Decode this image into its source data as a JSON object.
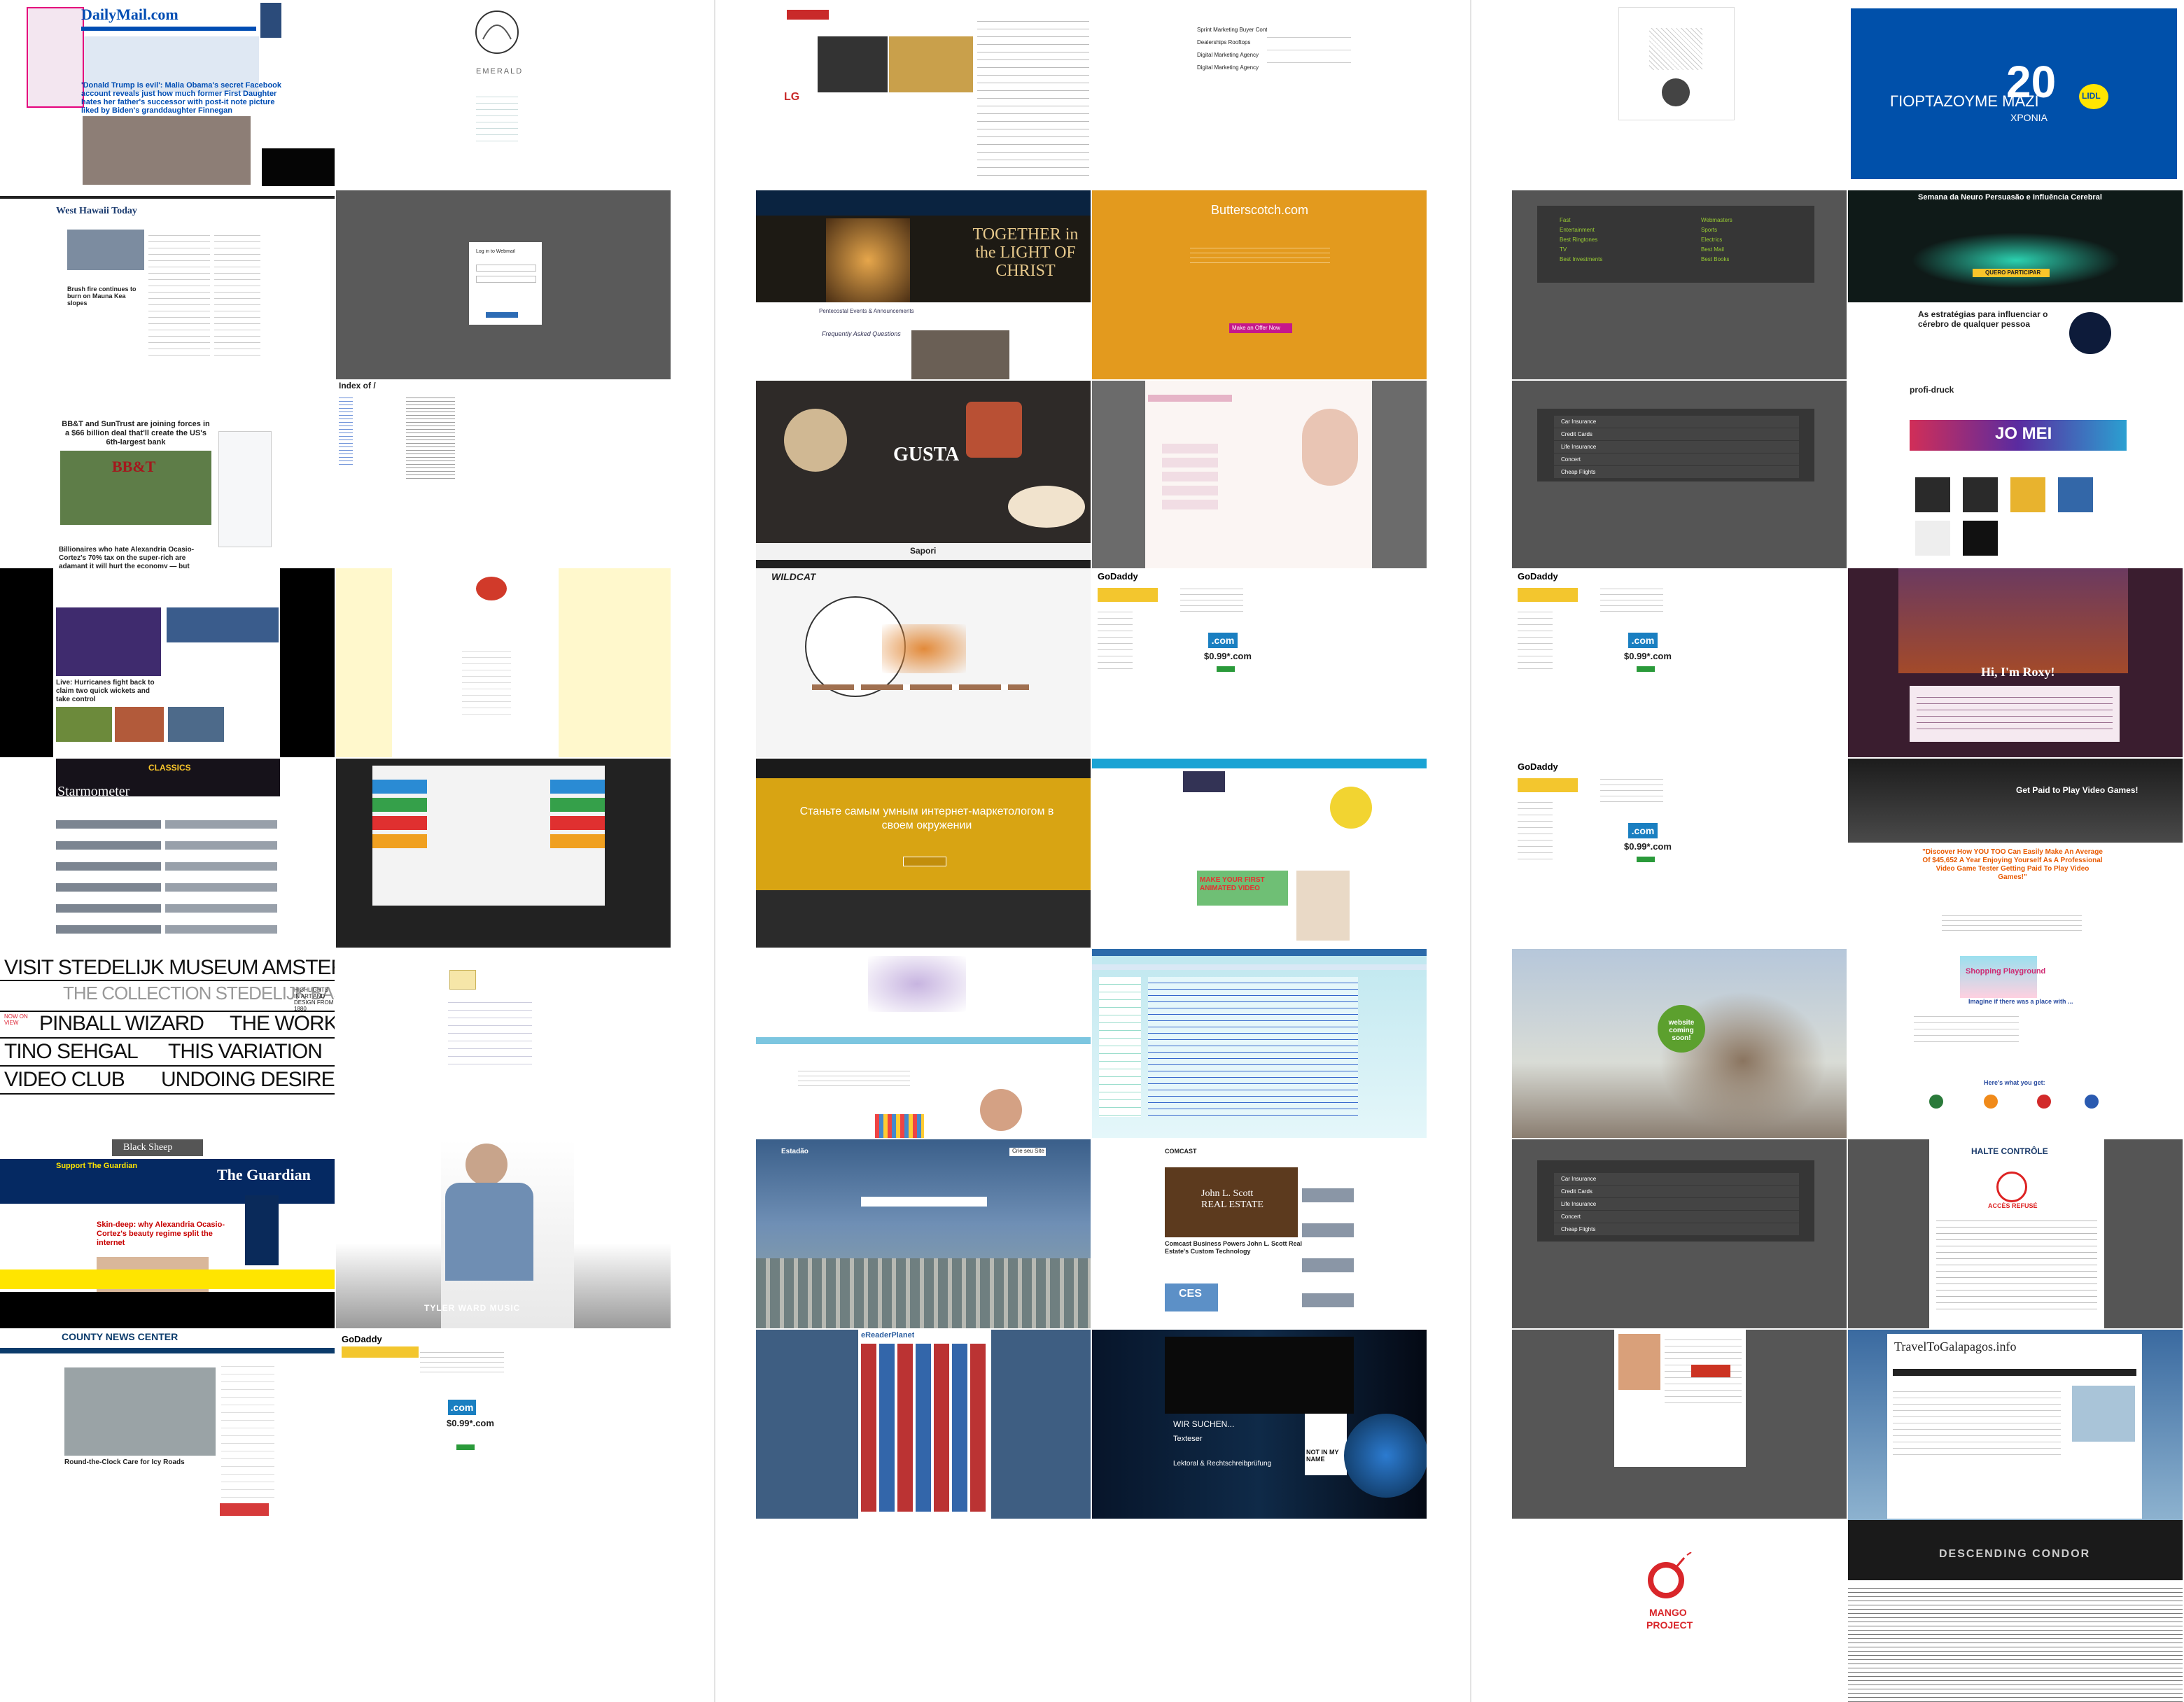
{
  "tiles": {
    "dailymail": {
      "logo": "DailyMail.com",
      "headline": "'Donald Trump is evil': Malia Obama's secret Facebook account reveals just how much former First Daughter hates her father's successor with post-it note picture liked by Biden's granddaughter Finnegan",
      "colors": {
        "brand": "#004db3",
        "accent": "#e4007c"
      }
    },
    "emerald": {
      "title": "EMERALD"
    },
    "chosun": {
      "lg": "LG"
    },
    "spreadsheet": {
      "rows": [
        "Sprint Marketing Buyer Contract",
        "Dealerships Rooftops",
        "Digital Marketing Agency",
        "Digital Marketing Agency"
      ]
    },
    "greetcard": {},
    "lidl": {
      "title": "ΓΙΟΡΤΑΖΟΥΜΕ ΜΑΖΙ",
      "number": "20",
      "sub": "ΧΡΟΝΙΑ",
      "brand": "LIDL",
      "colors": {
        "bg": "#0050aa",
        "accent": "#ffe500"
      }
    },
    "westhawaii": {
      "title": "West Hawaii Today",
      "headline": "Brush fire continues to burn on Mauna Kea slopes"
    },
    "login": {
      "title": "Log in to Webmail"
    },
    "arlington": {
      "title": "TOGETHER in the LIGHT OF CHRIST",
      "heading": "Pentecostal Events & Announcements",
      "sub": "Frequently Asked Questions"
    },
    "butterscotch": {
      "title": "Butterscotch.com",
      "button": "Make an Offer Now",
      "color": "#e39a1e"
    },
    "darkmenu1": {
      "items_left": [
        "Fast",
        "Entertainment",
        "Best Ringtones",
        "TV",
        "Best Investments"
      ],
      "items_right": [
        "Webmasters",
        "Sports",
        "Electrics",
        "Best Mail",
        "Best Books"
      ]
    },
    "neuro": {
      "title": "Semana da Neuro Persuasão e Influência Cerebral",
      "button": "QUERO PARTICIPAR",
      "heading": "As estratégias para influenciar o cérebro de qualquer pessoa"
    },
    "bbt": {
      "headline": "BB&T and SunTrust are joining forces in a $66 billion deal that'll create the US's 6th-largest bank",
      "logo": "BB&T",
      "headline2": "Billionaires who hate Alexandria Ocasio-Cortez's 70% tax on the super-rich are adamant it will hurt the economy — but history suggests otherwise"
    },
    "indexof": {
      "title": "Index of /"
    },
    "gusta": {
      "title": "GUSTA",
      "sub": "Sapori"
    },
    "blurpink": {},
    "darkmenu2": {
      "items": [
        "Car Insurance",
        "Credit Cards",
        "Life Insurance",
        "Concert",
        "Cheap Flights"
      ]
    },
    "profidruck": {
      "logo": "profi-druck",
      "banner": "JO MEI"
    },
    "hurricanes": {
      "headline": "Live: Hurricanes fight back to claim two quick wickets and take control"
    },
    "yellowsite": {},
    "wildcat": {
      "logo": "WILDCAT"
    },
    "godaddy1": {
      "logo": "GoDaddy",
      "domain": ".com",
      "price": "$0.99*.com"
    },
    "godaddy2": {
      "logo": "GoDaddy",
      "domain": ".com",
      "price": "$0.99*.com"
    },
    "roxy": {
      "title": "Hi, I'm Roxy!"
    },
    "starmometer": {
      "logo": "Starmometer",
      "banner": "CLASSICS"
    },
    "ribbons": {},
    "russian": {
      "title": "Станьте самым умным интернет-маркетологом в своем окружении"
    },
    "animated": {
      "banner": "MAKE YOUR FIRST ANIMATED VIDEO"
    },
    "godaddy3": {
      "logo": "GoDaddy",
      "domain": ".com",
      "price": "$0.99*.com"
    },
    "videogame": {
      "header": "Get Paid to Play Video Games!",
      "headline": "\"Discover How YOU TOO Can Easily Make An Average Of $45,652 A Year Enjoying Yourself As A Professional Video Game Tester Getting Paid To Play Video Games!\""
    },
    "stedelijk": {
      "lines": [
        "VISIT STEDELIJK MUSEUM AMSTERDA",
        "THE COLLECTION STEDELIJK BASE",
        "PINBALL WIZARD",
        "THE WORK A",
        "TINO SEHGAL",
        "THIS VARIATION",
        "VIDEO CLUB",
        "UNDOING DESIRE"
      ],
      "small": "HIGHLIGHTS IN ART AND DESIGN FROM 1880",
      "now": "NOW ON VIEW"
    },
    "bookpage": {},
    "nasserblog": {},
    "aquasite": {},
    "blursky": {
      "badge": "website coming soon!"
    },
    "shoppingplayground": {
      "title": "Shopping Playground",
      "sub": "Imagine if there was a place with ...",
      "what": "Here's what you get:"
    },
    "guardian": {
      "logo": "The Guardian",
      "support": "Support The Guardian",
      "headline": "Skin-deep: why Alexandria Ocasio-Cortez's beauty regime split the internet",
      "sheep": "Black Sheep"
    },
    "tylerward": {
      "caption": "TYLER WARD MUSIC"
    },
    "saopaulo": {
      "brand": "Estadão",
      "button": "Crie seu Site"
    },
    "comcast": {
      "logo": "COMCAST",
      "headline": "Comcast Business Powers John L. Scott Real Estate's Custom Technology",
      "realestate": "John L. Scott REAL ESTATE",
      "ces": "CES"
    },
    "darkmenu3": {
      "items": [
        "Car Insurance",
        "Credit Cards",
        "Life Insurance",
        "Concert",
        "Cheap Flights"
      ]
    },
    "haltecontrole": {
      "title": "HALTE CONTRÔLE",
      "denied": "ACCÈS REFUSÉ"
    },
    "countynews": {
      "logo": "COUNTY NEWS CENTER",
      "headline": "Round-the-Clock Care for Icy Roads"
    },
    "godaddy4": {
      "logo": "GoDaddy",
      "domain": ".com",
      "price": "$0.99*.com"
    },
    "ereader": {
      "logo": "eReaderPlanet"
    },
    "dark_ice": {
      "heading": "WIR SUCHEN...",
      "role": "Texteser",
      "role2": "Lektoral & Rechtschreibprüfung",
      "badge": "NOT IN MY NAME"
    },
    "grayframe": {},
    "galapagos": {
      "title": "TravelToGalapagos.info"
    },
    "mango": {
      "line1": "MANGO",
      "line2": "PROJECT",
      "color": "#d9262a"
    },
    "longtext": {
      "title": "DESCENDING CONDOR"
    }
  }
}
